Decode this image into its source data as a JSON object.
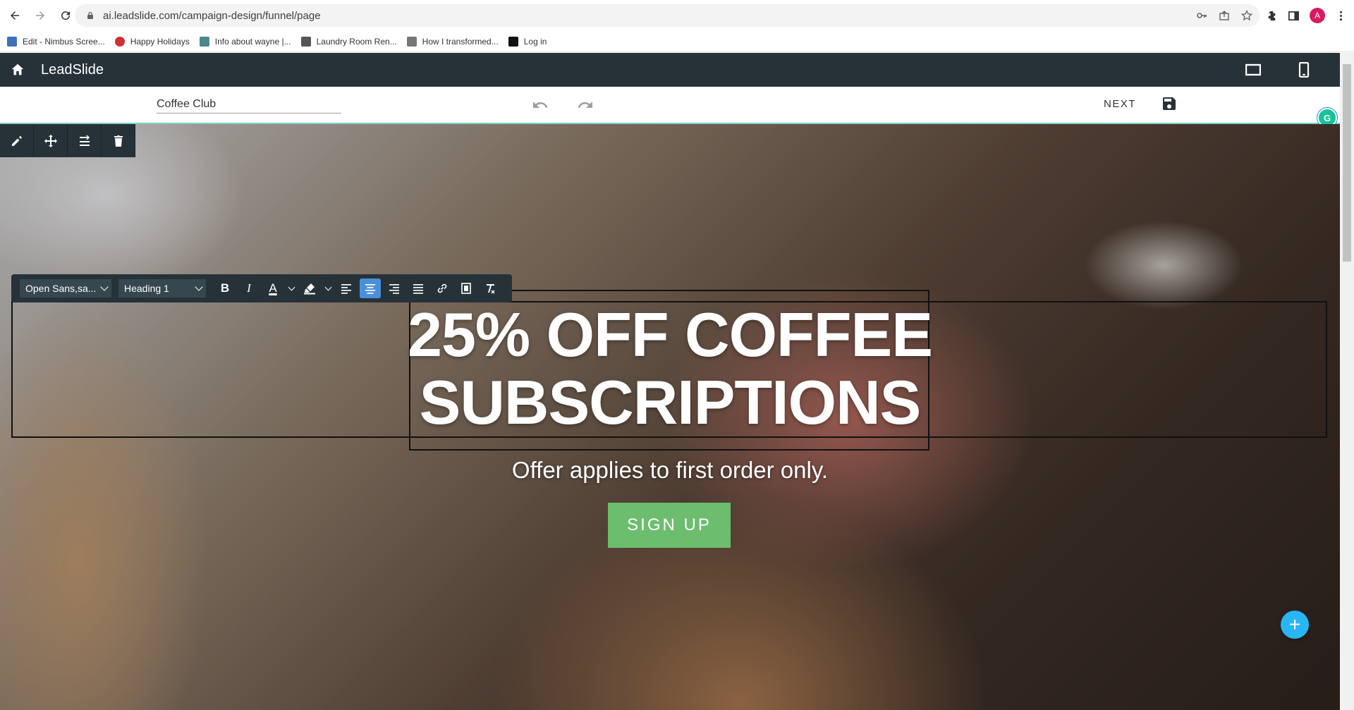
{
  "browser": {
    "url": "ai.leadslide.com/campaign-design/funnel/page",
    "bookmarks": [
      {
        "label": "Edit - Nimbus Scree...",
        "color": "#3b73b9"
      },
      {
        "label": "Happy Holidays",
        "color": "#d32f2f"
      },
      {
        "label": "Info about wayne |...",
        "color": "#4a8a8c"
      },
      {
        "label": "Laundry Room Ren...",
        "color": "#555555"
      },
      {
        "label": "How I transformed...",
        "color": "#777777"
      },
      {
        "label": "Log in",
        "color": "#111111"
      }
    ],
    "avatar_letter": "A"
  },
  "app": {
    "brand": "LeadSlide",
    "page_name": "Coffee Club",
    "next_label": "NEXT"
  },
  "format_bar": {
    "font": "Open Sans,sa...",
    "style": "Heading 1",
    "bold": "B",
    "italic": "I",
    "text_color": "A"
  },
  "content": {
    "headline": "25% OFF COFFEE SUBSCRIPTIONS",
    "subline": "Offer applies to first order only.",
    "button": "SIGN UP"
  },
  "colors": {
    "header_bg": "#263238",
    "button_bg": "#6dbd6f",
    "fab_bg": "#29b6f6",
    "active_align": "#4a90d9"
  }
}
